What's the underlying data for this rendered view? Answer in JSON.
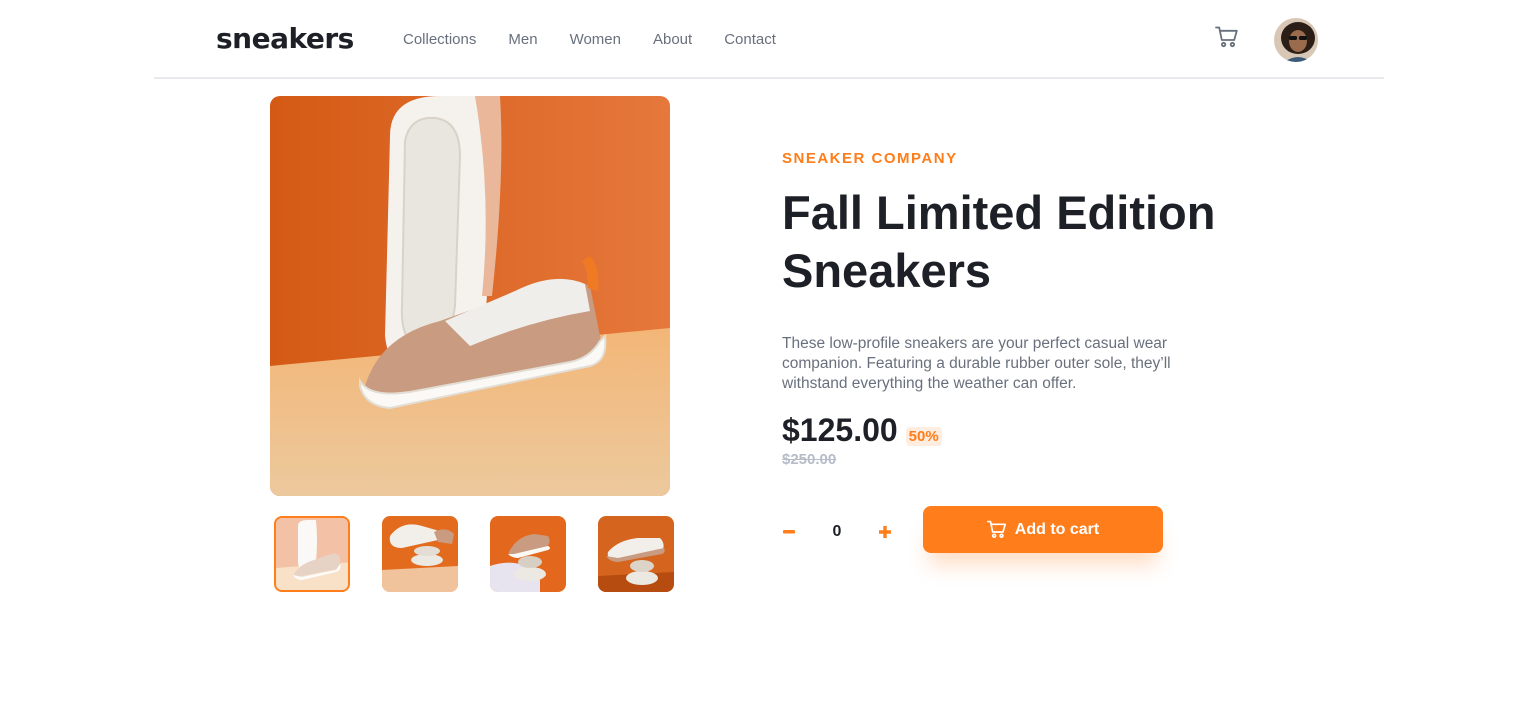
{
  "header": {
    "logo": "sneakers",
    "nav": [
      "Collections",
      "Men",
      "Women",
      "About",
      "Contact"
    ],
    "cart_icon": "cart-icon",
    "avatar_icon": "user-avatar"
  },
  "gallery": {
    "thumbnail_count": 4,
    "active_thumbnail": 1
  },
  "product": {
    "company": "SNEAKER COMPANY",
    "title_line1": "Fall Limited Edition",
    "title_line2": "Sneakers",
    "description": "These low-profile sneakers are your perfect casual wear companion. Featuring a durable rubber outer sole, they’ll withstand everything the weather can offer.",
    "price": "$125.00",
    "discount": "50%",
    "old_price": "$250.00"
  },
  "cart": {
    "quantity": "0",
    "add_label": "Add to cart"
  },
  "colors": {
    "accent": "#ff7d1a",
    "pale_accent": "#ffede0",
    "dark": "#1d2026",
    "grey": "#69707d"
  }
}
